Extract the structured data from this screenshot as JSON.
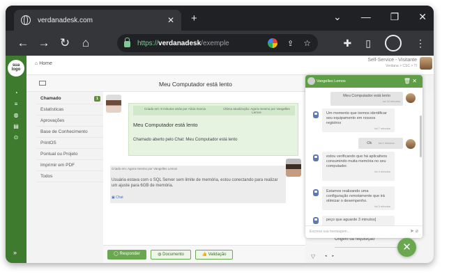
{
  "browser": {
    "tab_title": "verdanadesk.com",
    "tab_close": "✕",
    "new_tab": "+",
    "url_protocol": "https://",
    "url_host": "verdanadesk",
    "url_path": "/exemple"
  },
  "header": {
    "home": "Home",
    "self_service": "Self-Service - Visitante",
    "self_service_sub": "Verdana > CSC > TI"
  },
  "logo": {
    "line1": "sua",
    "line2": "logo"
  },
  "ticket": {
    "title": "Meu Computador está lento"
  },
  "left_nav": {
    "items": [
      {
        "label": "Chamado",
        "badge": "1"
      },
      {
        "label": "Estatísticas"
      },
      {
        "label": "Aprovações"
      },
      {
        "label": "Base de Conhecimento"
      },
      {
        "label": "PrintOS"
      },
      {
        "label": "Pontual ou Projeto"
      },
      {
        "label": "Imprimir em PDF"
      },
      {
        "label": "Todos"
      }
    ]
  },
  "timeline": {
    "followup": {
      "meta_left": "Criado em: 8 minutos atrás por Alicia Garcia",
      "meta_right": "Última atualização: Agora mesmo por Vangelles Lemos",
      "subject": "Meu Computador está lento",
      "body": "Chamado aberto pelo Chat: Meu Computador está lento"
    },
    "task": {
      "meta": "Criado em: Agora mesmo por Vangelles Lemos",
      "body": "Usuária estava com o SQL Server sem limite de memória, estou conectando para realizar um ajuste para 6GB de memória.",
      "tag": "Chat"
    }
  },
  "actions": {
    "reply": "Responder",
    "document": "Documento",
    "validation": "Validação"
  },
  "right_panel": {
    "origem": "Origem da requisição"
  },
  "chat": {
    "agent_name": "Vangelles Lemos",
    "messages": [
      {
        "from": "user",
        "text": "Meu Computador está lento",
        "time": "há 10 minutos"
      },
      {
        "from": "agent",
        "text": "Um momento que iremos identificar seu equipamento em nossos registros",
        "time": "há 7 minutos"
      },
      {
        "from": "user",
        "text": "Ok",
        "time": "há 6 minutos"
      },
      {
        "from": "agent",
        "text": "estou verificando que há aplicativos consumindo muita memória no seu computador.",
        "time": "há 4 minutos"
      },
      {
        "from": "agent",
        "text": "Estamos realizando uma configuração remotamente que irá otimizar o desempenho.",
        "time": "há 3 minutos"
      },
      {
        "from": "agent",
        "text": "peço que aguarde 3 minutos]",
        "time": ""
      }
    ],
    "input_placeholder": "Escreva sua mensagem..."
  },
  "colors": {
    "brand_green": "#3e7b2e",
    "accent_green": "#6aa84f"
  }
}
